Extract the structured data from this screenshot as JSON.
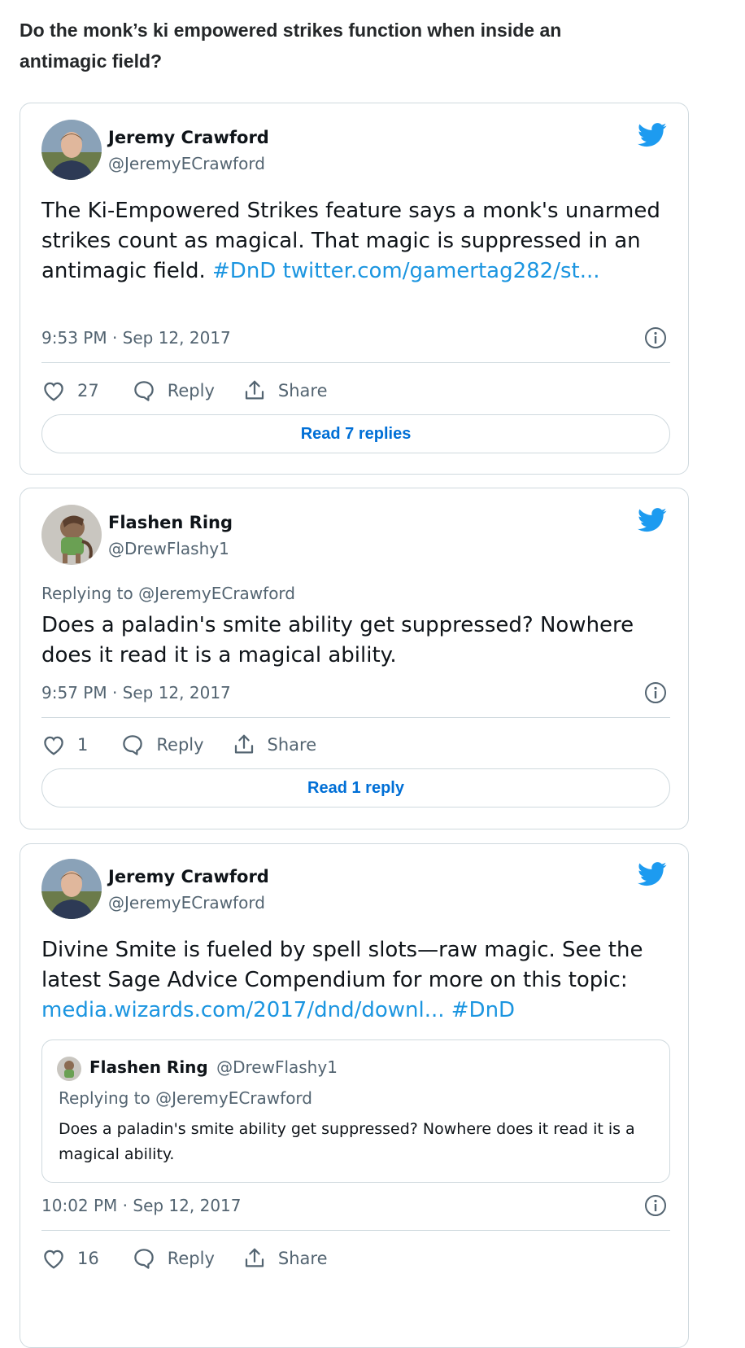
{
  "page": {
    "question": "Do the monk’s ki empowered strikes function when inside an antimagic field?"
  },
  "tweets": [
    {
      "author": "Jeremy Crawford",
      "handle": "@JeremyECrawford",
      "text_plain": "The Ki-Empowered Strikes feature says a monk's unarmed strikes count as magical. That magic is suppressed in an antimagic field.",
      "hashtag": "#DnD",
      "link": "twitter.com/gamertag282/st...",
      "timestamp": "9:53 PM · Sep 12, 2017",
      "likes": "27",
      "reply_label": "Reply",
      "share_label": "Share",
      "read_replies": "Read 7 replies"
    },
    {
      "author": "Flashen Ring",
      "handle": "@DrewFlashy1",
      "replying_to": "Replying to @JeremyECrawford",
      "text_plain": "Does a paladin's smite ability get suppressed? Nowhere does it read it is a magical ability.",
      "timestamp": "9:57 PM · Sep 12, 2017",
      "likes": "1",
      "reply_label": "Reply",
      "share_label": "Share",
      "read_replies": "Read 1 reply"
    },
    {
      "author": "Jeremy Crawford",
      "handle": "@JeremyECrawford",
      "text_plain": "Divine Smite is fueled by spell slots—raw magic. See the latest Sage Advice Compendium for more on this topic:",
      "link": "media.wizards.com/2017/dnd/downl...",
      "hashtag": "#DnD",
      "quote": {
        "author": "Flashen Ring",
        "handle": "@DrewFlashy1",
        "replying_to": "Replying to @JeremyECrawford",
        "text": "Does a paladin's smite ability get suppressed? Nowhere does it read it is a magical ability."
      },
      "timestamp": "10:02 PM · Sep 12, 2017",
      "likes": "16",
      "reply_label": "Reply",
      "share_label": "Share"
    }
  ],
  "colors": {
    "link": "#1b95e0",
    "twitter_blue": "#1d9bf0",
    "button_text": "#006fd6",
    "muted": "#536471",
    "border": "#cfd9de"
  },
  "icons": [
    "twitter-bird-icon",
    "info-icon",
    "heart-icon",
    "reply-bubble-icon",
    "share-icon"
  ]
}
